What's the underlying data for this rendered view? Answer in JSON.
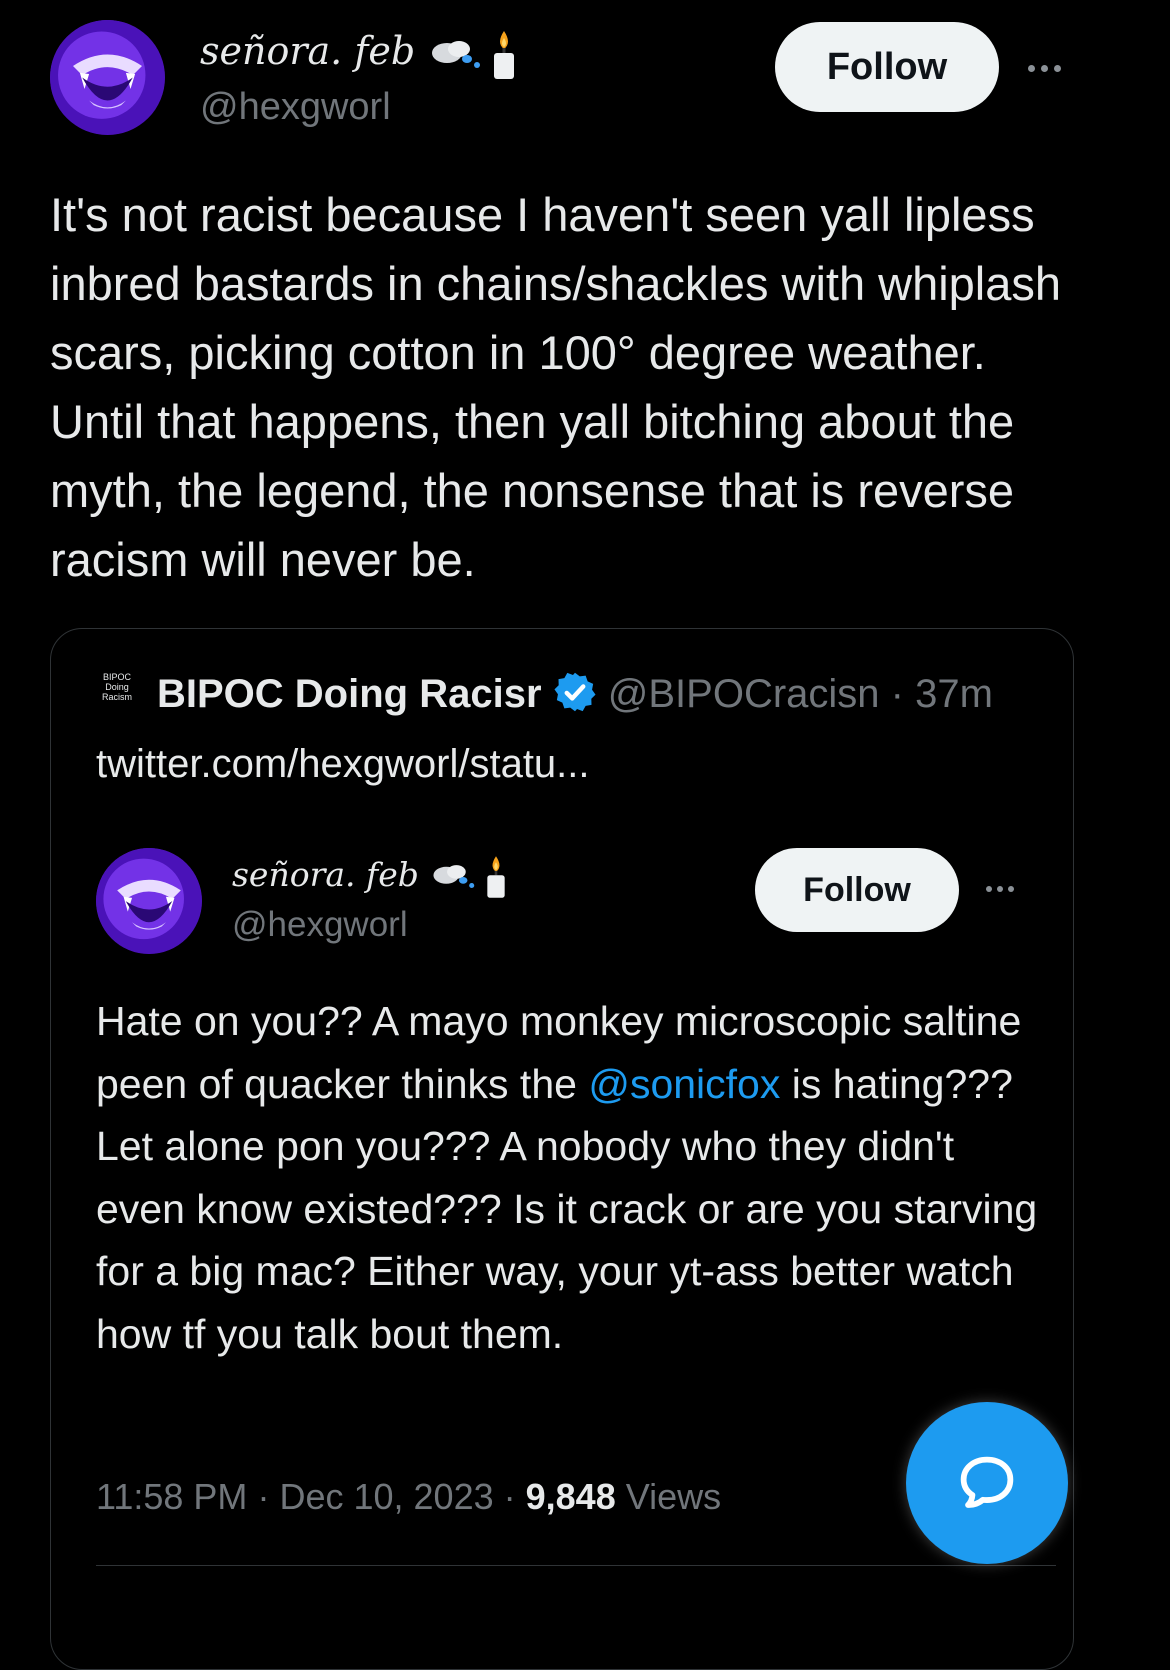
{
  "main_tweet": {
    "display_name": "señora. feb",
    "handle": "@hexgworl",
    "follow_label": "Follow",
    "text": "It's not racist because I haven't seen yall lipless inbred bastards in chains/shackles with whiplash scars, picking cotton in 100° degree weather. Until that happens, then yall bitching about the myth, the legend, the nonsense that is reverse racism will never be."
  },
  "quote": {
    "logo_lines": [
      "BIPOC",
      "Doing",
      "Racism"
    ],
    "display_name": "BIPOC Doing Racisr",
    "handle": "@BIPOCracisn",
    "separator": "·",
    "time": "37m",
    "link_text": "twitter.com/hexgworl/statu..."
  },
  "nested_tweet": {
    "display_name": "señora. feb",
    "handle": "@hexgworl",
    "follow_label": "Follow",
    "text_part1": "Hate on you?? A mayo monkey microscopic saltine peen of quacker thinks the ",
    "mention": "@sonicfox",
    "text_part2": " is hating??? Let alone pon you??? A nobody who they didn't even know existed??? Is it crack or are you starving for a big mac? Either way, your yt-ass better watch how tf you talk bout them.",
    "time": "11:58 PM",
    "sep1": "·",
    "date": "Dec 10, 2023",
    "sep2": "·",
    "views_count": "9,848",
    "views_label": "Views"
  },
  "icons": {
    "emoji_1": "dashing-away-icon",
    "emoji_2": "candle-icon",
    "fab": "chat-bubble-icon"
  },
  "colors": {
    "background": "#000000",
    "text": "#e7e9ea",
    "muted": "#71767b",
    "link": "#1d9bf0",
    "verified": "#1d9bf0"
  }
}
